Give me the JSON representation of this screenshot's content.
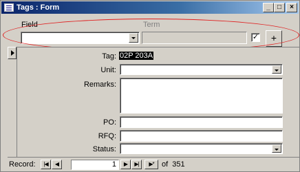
{
  "window": {
    "title": "Tags : Form",
    "min_symbol": "_",
    "max_symbol": "□",
    "close_symbol": "×"
  },
  "header": {
    "field_label": "Field",
    "term_label": "Term",
    "field_value": "",
    "term_value": "",
    "checkbox_checked": true,
    "checkbox_mark": "✓",
    "add_button_label": "+"
  },
  "form": {
    "tag_label": "Tag:",
    "tag_value": "02P 203A",
    "unit_label": "Unit:",
    "unit_value": "",
    "remarks_label": "Remarks:",
    "remarks_value": "",
    "po_label": "PO:",
    "po_value": "",
    "rfq_label": "RFQ:",
    "rfq_value": "",
    "status_label": "Status:",
    "status_value": ""
  },
  "navigation": {
    "record_label": "Record:",
    "first_symbol": "|◀",
    "prev_symbol": "◀",
    "next_symbol": "▶",
    "last_symbol": "▶|",
    "new_symbol": "▶*",
    "current_record": "1",
    "of_text": "of  351"
  },
  "annotation": {
    "highlight_color": "#e02020"
  }
}
